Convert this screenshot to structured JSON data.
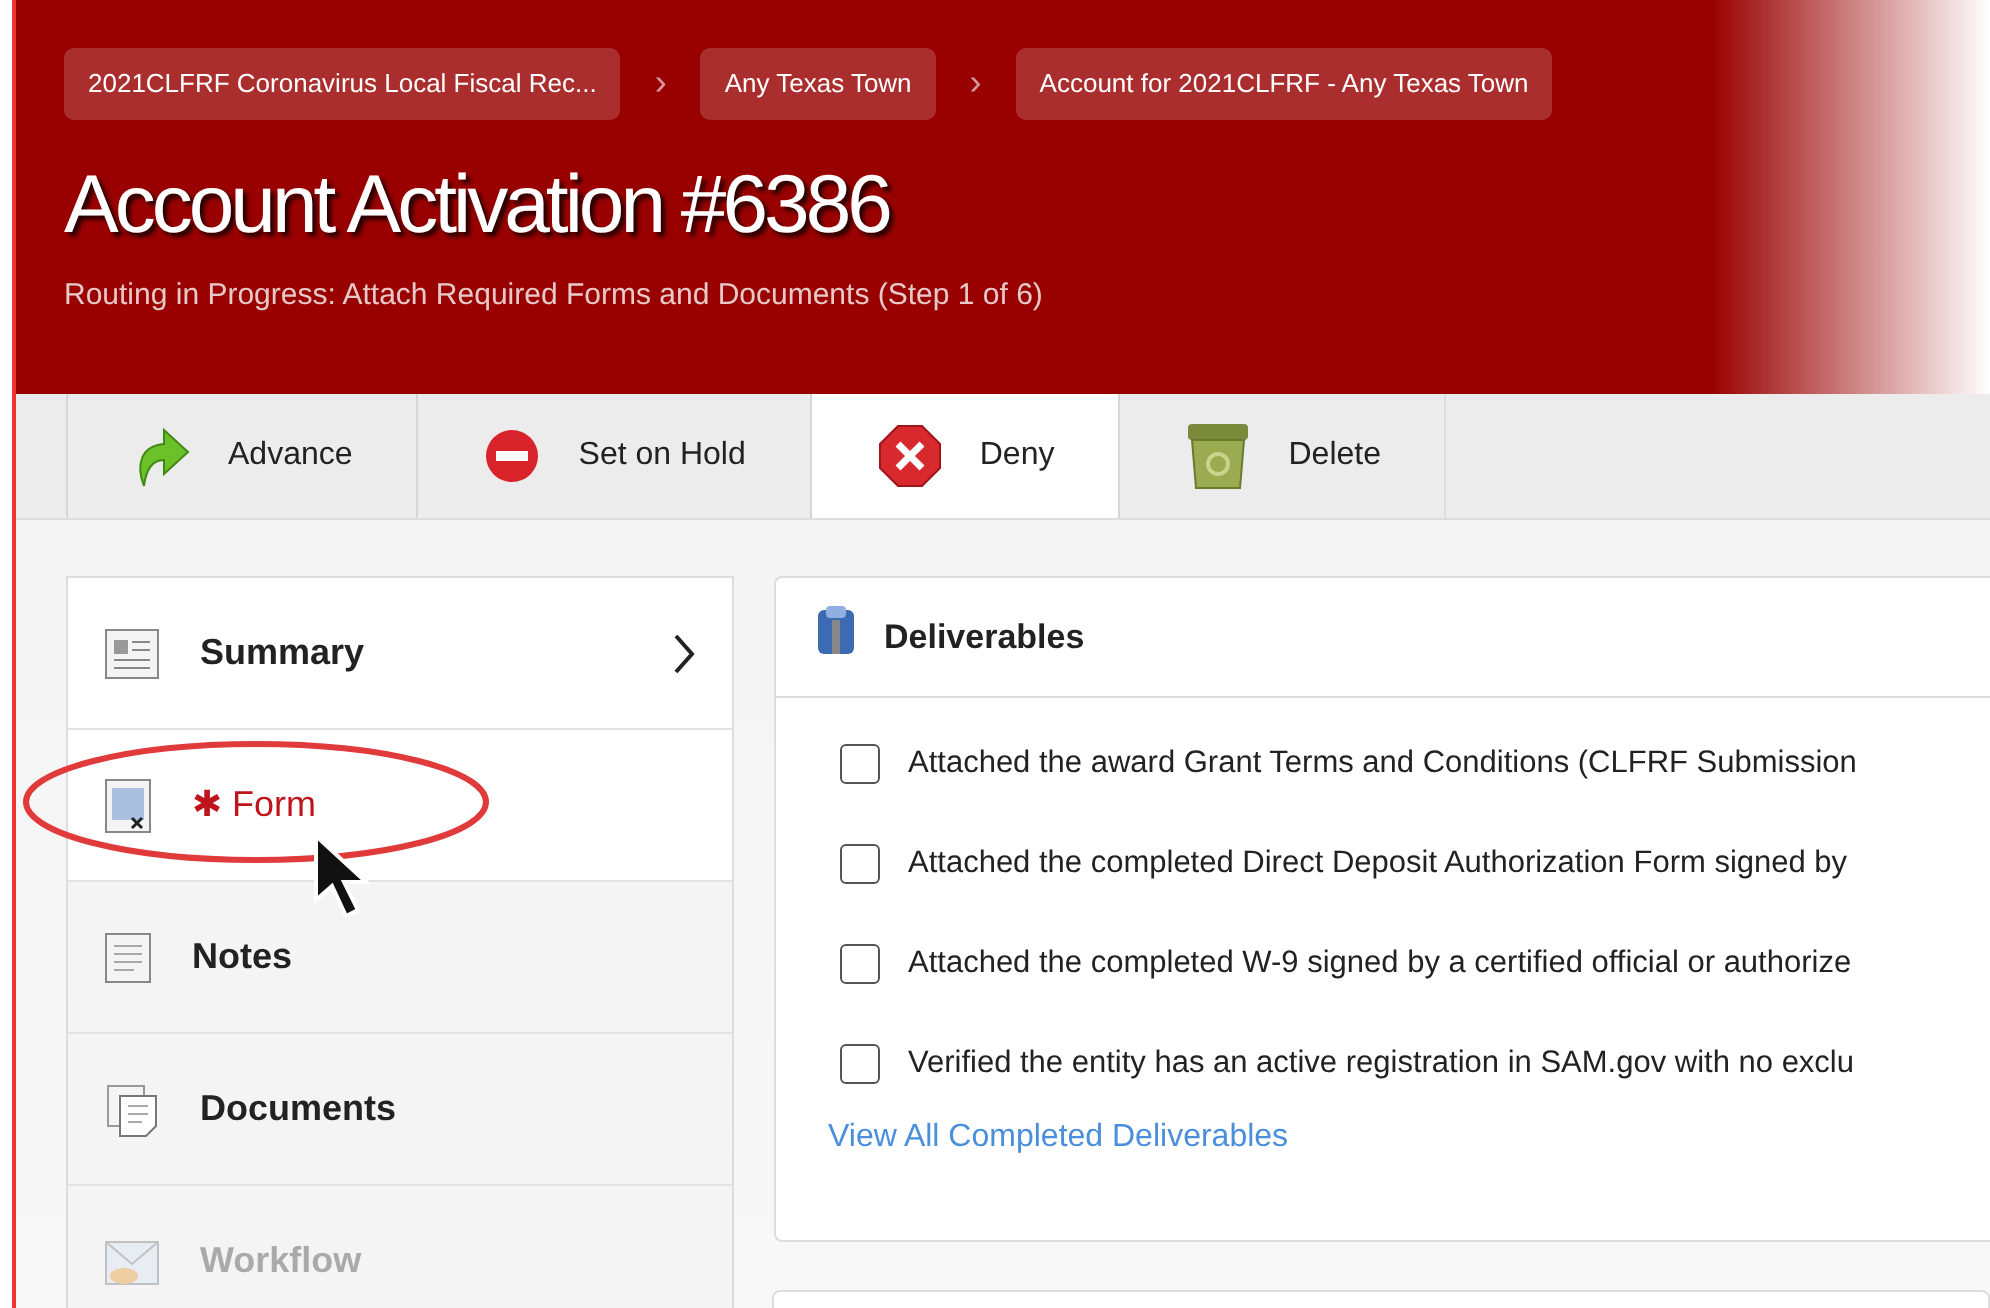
{
  "breadcrumbs": [
    {
      "label": "2021CLFRF Coronavirus Local Fiscal Rec..."
    },
    {
      "label": "Any Texas Town"
    },
    {
      "label": "Account for 2021CLFRF - Any Texas Town"
    }
  ],
  "breadcrumb_separator": "›",
  "title": "Account Activation #6386",
  "subtitle": "Routing in Progress: Attach Required Forms and Documents (Step 1 of 6)",
  "toolbar": [
    {
      "label": "Advance",
      "kind": "advance",
      "selected": false
    },
    {
      "label": "Set on Hold",
      "kind": "hold",
      "selected": false
    },
    {
      "label": "Deny",
      "kind": "deny",
      "selected": true
    },
    {
      "label": "Delete",
      "kind": "delete",
      "selected": false
    }
  ],
  "sidebar": {
    "items": [
      {
        "label": "Summary",
        "kind": "summary",
        "active": true,
        "arrow": true,
        "disabled": false
      },
      {
        "label": "Form",
        "kind": "form",
        "active": true,
        "arrow": false,
        "disabled": false,
        "marker": "✱"
      },
      {
        "label": "Notes",
        "kind": "notes",
        "active": false,
        "arrow": false,
        "disabled": false
      },
      {
        "label": "Documents",
        "kind": "documents",
        "active": false,
        "arrow": false,
        "disabled": false
      },
      {
        "label": "Workflow",
        "kind": "workflow",
        "active": false,
        "arrow": false,
        "disabled": true
      }
    ]
  },
  "deliverables": {
    "title": "Deliverables",
    "items": [
      {
        "label": "Attached the award Grant Terms and Conditions (CLFRF Submission",
        "checked": false
      },
      {
        "label": "Attached the completed Direct Deposit Authorization Form signed by",
        "checked": false
      },
      {
        "label": "Attached the completed W-9 signed by a certified official or authorize",
        "checked": false
      },
      {
        "label": "Verified the entity has an active registration in SAM.gov with no exclu",
        "checked": false
      }
    ],
    "link": "View All Completed Deliverables"
  }
}
